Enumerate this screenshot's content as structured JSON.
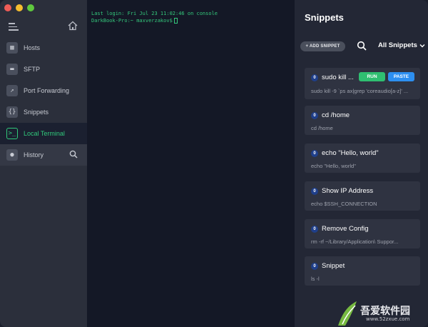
{
  "sidebar": {
    "items": [
      {
        "label": "Hosts",
        "icon": "hosts-icon",
        "glyph": "▦"
      },
      {
        "label": "SFTP",
        "icon": "folder-icon",
        "glyph": "▬"
      },
      {
        "label": "Port Forwarding",
        "icon": "port-forwarding-icon",
        "glyph": "↗"
      },
      {
        "label": "Snippets",
        "icon": "snippets-icon",
        "glyph": "{}"
      },
      {
        "label": "Local Terminal",
        "icon": "terminal-icon",
        "glyph": ">_"
      },
      {
        "label": "History",
        "icon": "clock-icon",
        "glyph": "●"
      }
    ]
  },
  "terminal": {
    "line1": "Last login: Fri Jul 23 11:02:46 on console",
    "line2": "DarkBook-Pro:~ maxverzakov$"
  },
  "panel": {
    "title": "Snippets",
    "add_label": "+ ADD SNIPPET",
    "filter_label": "All Snippets"
  },
  "snippets": [
    {
      "badge": "0",
      "name": "sudo kill ...",
      "cmd": "sudo kill -9 `ps ax|grep 'coreaudio[a-z]' ...",
      "run": "RUN",
      "paste": "PASTE"
    },
    {
      "badge": "0",
      "name": "cd /home",
      "cmd": "cd /home"
    },
    {
      "badge": "0",
      "name": "echo \"Hello, world\"",
      "cmd": "echo \"Hello, world\""
    },
    {
      "badge": "0",
      "name": "Show IP Address",
      "cmd": "echo $SSH_CONNECTION"
    },
    {
      "badge": "0",
      "name": "Remove Config",
      "cmd": "rm -rf ~/Library/Application\\ Suppor..."
    },
    {
      "badge": "0",
      "name": "Snippet",
      "cmd": "ls -l"
    }
  ],
  "watermark": {
    "text": "吾爱软件园",
    "url": "www.52zxue.com"
  },
  "colors": {
    "accent_green": "#30c97b",
    "run_green": "#2fbf71",
    "paste_blue": "#2d8ff0"
  }
}
